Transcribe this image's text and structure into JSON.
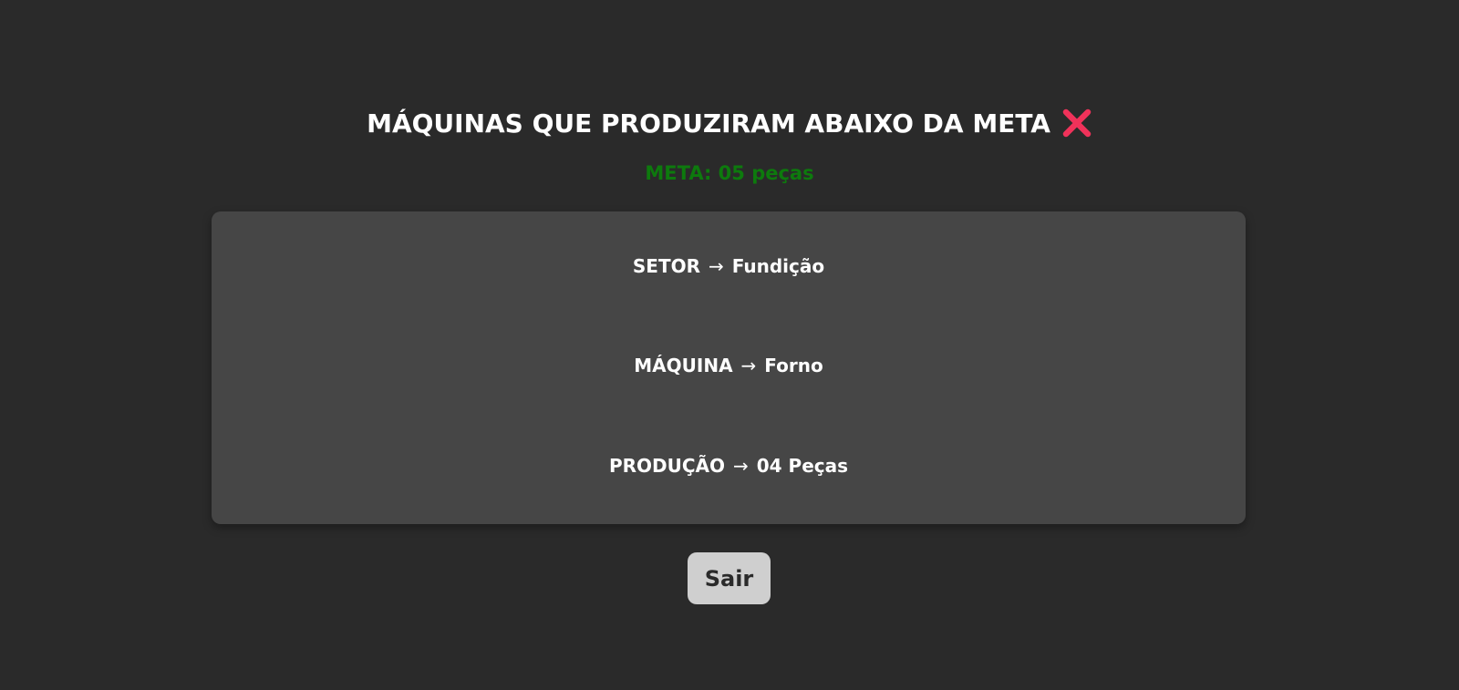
{
  "header": {
    "title": "MÁQUINAS QUE PRODUZIRAM ABAIXO DA META",
    "title_icon": "cross-mark-icon",
    "title_icon_color": "#f0325a",
    "goal": "META: 05 peças",
    "goal_color": "#0d7a0d"
  },
  "card": {
    "rows": [
      {
        "label": "SETOR",
        "arrow": "→",
        "value": "Fundição"
      },
      {
        "label": "MÁQUINA",
        "arrow": "→",
        "value": "Forno"
      },
      {
        "label": "PRODUÇÃO",
        "arrow": "→",
        "value": "04 Peças"
      }
    ]
  },
  "actions": {
    "exit_label": "Sair"
  },
  "colors": {
    "background": "#2a2a2a",
    "card": "#464646",
    "button": "#cfcfcf"
  }
}
